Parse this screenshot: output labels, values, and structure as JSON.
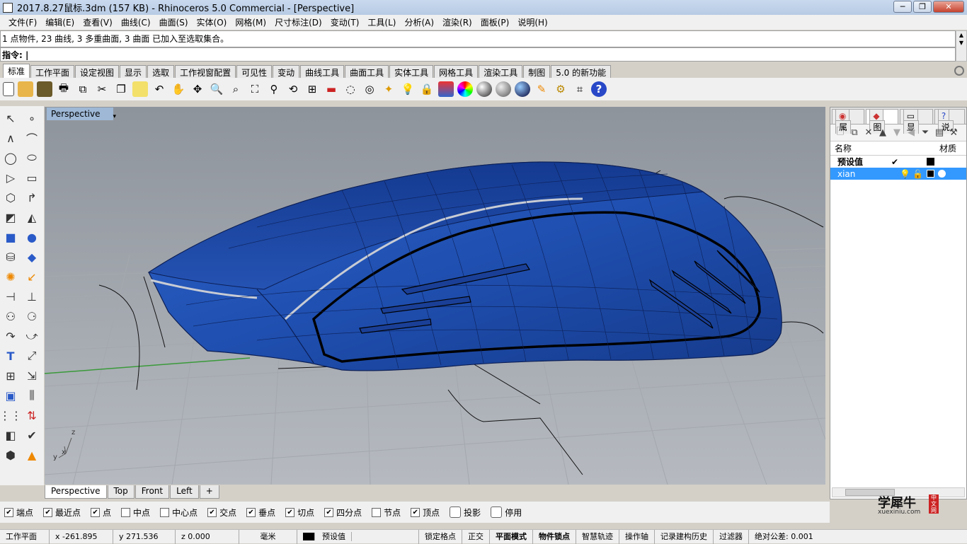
{
  "window": {
    "title": "2017.8.27鼠标.3dm (157 KB) - Rhinoceros 5.0 Commercial - [Perspective]",
    "min": "─",
    "max": "❐",
    "close": "✕"
  },
  "menu": [
    "文件(F)",
    "编辑(E)",
    "查看(V)",
    "曲线(C)",
    "曲面(S)",
    "实体(O)",
    "网格(M)",
    "尺寸标注(D)",
    "变动(T)",
    "工具(L)",
    "分析(A)",
    "渲染(R)",
    "面板(P)",
    "说明(H)"
  ],
  "command": {
    "history": "1 点物件, 23 曲线, 3 多重曲面, 3 曲面 已加入至选取集合。",
    "prompt": "指令:"
  },
  "toolbar_tabs": [
    "标准",
    "工作平面",
    "设定视图",
    "显示",
    "选取",
    "工作视窗配置",
    "可见性",
    "变动",
    "曲线工具",
    "曲面工具",
    "实体工具",
    "网格工具",
    "渲染工具",
    "制图",
    "5.0 的新功能"
  ],
  "toolbar_icons": [
    "new-icon",
    "open-icon",
    "save-icon",
    "print-icon",
    "import-icon",
    "cut-icon",
    "copy-icon",
    "paste-icon",
    "undo-icon",
    "pan-icon",
    "rotate-icon",
    "zoom-icon",
    "zoom-window-icon",
    "zoom-extents-icon",
    "zoom-selected-icon",
    "rotate-view-icon",
    "four-view-icon",
    "car-icon",
    "ghost-icon",
    "target-icon",
    "point-icon",
    "light-icon",
    "lock-icon",
    "layer-icon",
    "color-wheel-icon",
    "sphere-shaded-icon",
    "sphere-render-icon",
    "sphere-blue-icon",
    "render-icon",
    "settings-icon",
    "grid-snap-icon",
    "help-icon"
  ],
  "viewport": {
    "name": "Perspective",
    "dropdown": "▾",
    "axis_z": "z",
    "axis_y": "y",
    "axis_x": "x"
  },
  "viewport_tabs": [
    "Perspective",
    "Top",
    "Front",
    "Left",
    "+"
  ],
  "panel": {
    "tabs": [
      "属",
      "图",
      "显",
      "说"
    ],
    "columns": {
      "name": "名称",
      "material": "材质"
    },
    "layers": [
      {
        "name": "预设值",
        "check": "✔"
      },
      {
        "name": "xian"
      }
    ]
  },
  "osnaps": [
    {
      "label": "端点",
      "on": true
    },
    {
      "label": "最近点",
      "on": true
    },
    {
      "label": "点",
      "on": true
    },
    {
      "label": "中点",
      "on": false
    },
    {
      "label": "中心点",
      "on": false
    },
    {
      "label": "交点",
      "on": true
    },
    {
      "label": "垂点",
      "on": true
    },
    {
      "label": "切点",
      "on": true
    },
    {
      "label": "四分点",
      "on": true
    },
    {
      "label": "节点",
      "on": false
    },
    {
      "label": "顶点",
      "on": true
    },
    {
      "label": "投影",
      "on": false
    },
    {
      "label": "停用",
      "on": false
    }
  ],
  "status": {
    "cplane": "工作平面",
    "x": "x -261.895",
    "y": "y 271.536",
    "z": "z 0.000",
    "unit": "毫米",
    "layer": "预设值",
    "grid_snap": "锁定格点",
    "ortho": "正交",
    "planar": "平面模式",
    "osnap": "物件锁点",
    "smarttrack": "智慧轨迹",
    "gumball": "操作轴",
    "history": "记录建构历史",
    "filter": "过滤器",
    "tolerance": "绝对公差: 0.001"
  },
  "watermark": {
    "brand": "学犀牛",
    "url": "xuexiniu.com",
    "tag": "中文网"
  },
  "colors": {
    "mouse_body": "#1f4fb0",
    "viewport_bg": "#9aa0a8",
    "selection": "#3399ff"
  }
}
